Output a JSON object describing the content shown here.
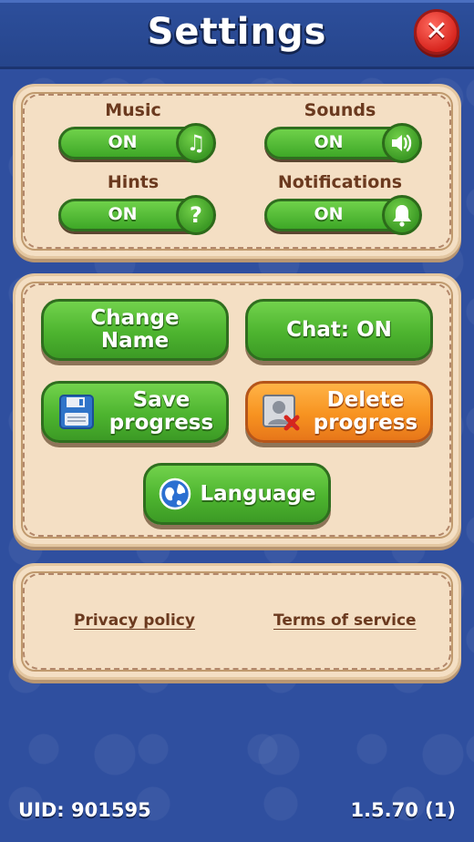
{
  "header": {
    "title": "Settings",
    "close_icon": "close-icon"
  },
  "toggles": [
    {
      "label": "Music",
      "state": "ON",
      "icon": "music-note-icon"
    },
    {
      "label": "Sounds",
      "state": "ON",
      "icon": "speaker-icon"
    },
    {
      "label": "Hints",
      "state": "ON",
      "icon": "question-mark-icon"
    },
    {
      "label": "Notifications",
      "state": "ON",
      "icon": "bell-icon"
    }
  ],
  "buttons": {
    "change_name": {
      "line1": "Change",
      "line2": "Name"
    },
    "chat": "Chat: ON",
    "save_progress": {
      "line1": "Save",
      "line2": "progress"
    },
    "delete_progress": {
      "line1": "Delete",
      "line2": "progress"
    },
    "language": "Language"
  },
  "links": {
    "privacy": "Privacy policy",
    "terms": "Terms of service"
  },
  "footer": {
    "uid": "UID: 901595",
    "version": "1.5.70 (1)"
  },
  "colors": {
    "background": "#2f4f9f",
    "panel": "#f4dfc4",
    "green": "#4db42f",
    "orange": "#f79320",
    "close": "#d8261f"
  }
}
